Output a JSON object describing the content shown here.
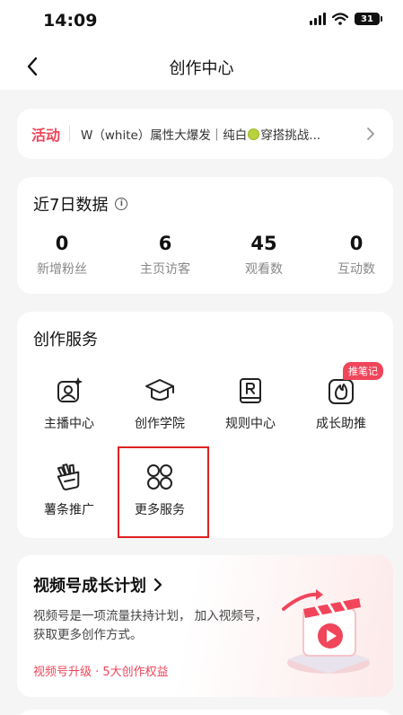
{
  "status_bar": {
    "time": "14:09",
    "battery": "31"
  },
  "nav": {
    "title": "创作中心"
  },
  "activity": {
    "tag": "活动",
    "text_before": "W（white）属性大爆发｜纯白",
    "text_after": "穿搭挑战..."
  },
  "stats": {
    "title": "近7日数据",
    "items": [
      {
        "value": "0",
        "label": "新增粉丝"
      },
      {
        "value": "6",
        "label": "主页访客"
      },
      {
        "value": "45",
        "label": "观看数"
      },
      {
        "value": "0",
        "label": "互动数"
      }
    ]
  },
  "services": {
    "title": "创作服务",
    "items": [
      {
        "label": "主播中心",
        "icon": "anchor-center-icon"
      },
      {
        "label": "创作学院",
        "icon": "graduation-cap-icon"
      },
      {
        "label": "规则中心",
        "icon": "rules-book-icon"
      },
      {
        "label": "成长助推",
        "icon": "flame-icon",
        "badge": "推笔记"
      },
      {
        "label": "薯条推广",
        "icon": "fries-icon"
      },
      {
        "label": "更多服务",
        "icon": "more-grid-icon"
      }
    ]
  },
  "growth": {
    "title": "视频号成长计划",
    "desc": "视频号是一项流量扶持计划， 加入视频号，获取更多创作方式。",
    "footer": "视频号升级 · 5大创作权益"
  },
  "colors": {
    "accent": "#f0455a",
    "highlight": "#e02020"
  }
}
